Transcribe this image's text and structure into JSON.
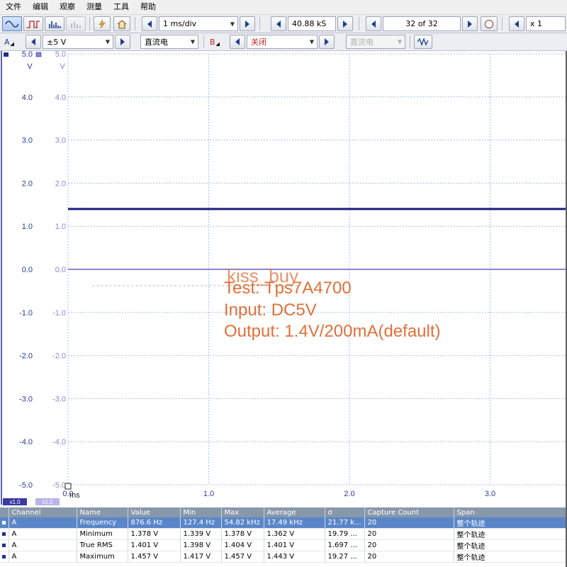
{
  "menu": [
    "文件",
    "编辑",
    "观察",
    "测量",
    "工具",
    "帮助"
  ],
  "toolbar": {
    "timebase": "1 ms/div",
    "samples": "40.88 kS",
    "capture": "32 of 32",
    "zoom": "x 1"
  },
  "channel_a": {
    "label": "A",
    "range": "±5 V",
    "coupling": "直流电"
  },
  "channel_b": {
    "label": "B",
    "range": "关闭",
    "coupling": "直流电"
  },
  "scope": {
    "y_min": -5.0,
    "y_max": 5.0,
    "y_ticks": [
      "5.0",
      "4.0",
      "3.0",
      "2.0",
      "1.0",
      "0.0",
      "-1.0",
      "-2.0",
      "-3.0",
      "-4.0",
      "-5.0"
    ],
    "y_unit": "V",
    "x_ticks": [
      "0.0",
      "1.0",
      "2.0",
      "3.0"
    ],
    "x_unit": "ms",
    "x_per_div_ms": 1.0,
    "trace_a_volts": 1.4,
    "trace_b_volts": 0.0,
    "trace_a_color": "#1c1c80",
    "trace_b_color": "#8a86d0",
    "scale_a": "x1.0",
    "scale_b": "x1.0"
  },
  "overlay": {
    "watermark": "kiss_buy",
    "lines": [
      "Test: Tps7A4700",
      "Input: DC5V",
      "Output: 1.4V/200mA(default)"
    ],
    "color": "#e0703a"
  },
  "stats": {
    "columns": [
      "Channel",
      "Name",
      "Value",
      "Min",
      "Max",
      "Average",
      "σ",
      "Capture Count",
      "Span"
    ],
    "rows": [
      [
        "A",
        "Frequency",
        "876.6 Hz",
        "127.4 Hz",
        "54.82 kHz",
        "17.49 kHz",
        "21.77 k...",
        "20",
        "整个轨迹"
      ],
      [
        "A",
        "Minimum",
        "1.378 V",
        "1.339 V",
        "1.378 V",
        "1.362 V",
        "19.79 ...",
        "20",
        "整个轨迹"
      ],
      [
        "A",
        "True RMS",
        "1.401 V",
        "1.398 V",
        "1.404 V",
        "1.401 V",
        "1.697 ...",
        "20",
        "整个轨迹"
      ],
      [
        "A",
        "Maximum",
        "1.457 V",
        "1.417 V",
        "1.457 V",
        "1.443 V",
        "19.27 ...",
        "20",
        "整个轨迹"
      ]
    ]
  }
}
